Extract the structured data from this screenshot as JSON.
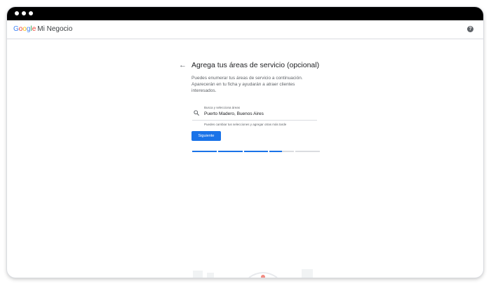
{
  "window": {
    "controls": [
      "close",
      "minimize",
      "maximize"
    ]
  },
  "header": {
    "brand_letters": [
      {
        "char": "G",
        "color": "#4285f4"
      },
      {
        "char": "o",
        "color": "#ea4335"
      },
      {
        "char": "o",
        "color": "#fbbc05"
      },
      {
        "char": "g",
        "color": "#4285f4"
      },
      {
        "char": "l",
        "color": "#34a853"
      },
      {
        "char": "e",
        "color": "#ea4335"
      }
    ],
    "product": "Mi Negocio",
    "help_icon": "?"
  },
  "main": {
    "back_icon": "←",
    "title": "Agrega tus áreas de servicio (opcional)",
    "description": "Puedes enumerar tus áreas de servicio a continuación. Aparecerán en tu ficha y ayudarán a atraer clientes interesados.",
    "search": {
      "label": "Busca y selecciona áreas",
      "value": "Puerto Madero, Buenos Aires",
      "icon": "search-icon"
    },
    "helper_text": "Puedes cambiar tus selecciones y agregar otras más tarde",
    "next_label": "Siguiente",
    "progress": {
      "segments": 5,
      "completed": 3.5,
      "active_color": "#1a73e8",
      "inactive_color": "#dadce0"
    }
  }
}
